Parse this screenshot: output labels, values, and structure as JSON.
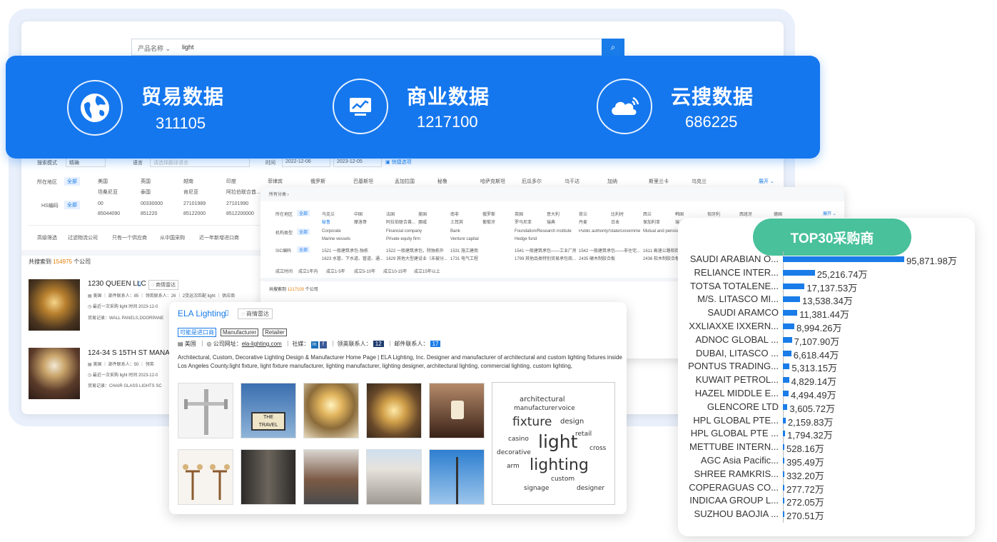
{
  "search": {
    "category": "产品名称",
    "query": "light"
  },
  "stats": [
    {
      "title": "贸易数据",
      "value": "311105"
    },
    {
      "title": "商业数据",
      "value": "1217100"
    },
    {
      "title": "云搜数据",
      "value": "686225"
    }
  ],
  "filters": {
    "search_mode_label": "搜索模式",
    "search_mode_value": "精确",
    "language_label": "语言",
    "language_placeholder": "请选择翻译语言",
    "time_label": "时间",
    "date_from": "2022-12-06",
    "date_to": "2023-12-05",
    "quick_option": "快捷选项",
    "region_label": "所在地区",
    "all": "全部",
    "regions": [
      "美国",
      "英国",
      "越南",
      "印度",
      "菲律宾",
      "俄罗斯",
      "巴基斯坦",
      "孟加拉国",
      "秘鲁",
      "哈萨克斯坦",
      "厄瓜多尔",
      "乌干达",
      "加纳",
      "斯里兰卡",
      "乌克兰"
    ],
    "regions_row2": [
      "坦桑尼亚",
      "泰国",
      "肯尼亚",
      "阿拉伯联合酋..."
    ],
    "hs_label": "HS编码",
    "hs_codes": [
      "00",
      "00330000",
      "27101989",
      "27101990"
    ],
    "hs_codes_row2": [
      "85044090",
      "851220",
      "85122000",
      "8512200000"
    ],
    "expand": "展开",
    "advanced_label": "高级筛选",
    "advanced_options": [
      "过滤物流公司",
      "只有一个供应商",
      "从中国采购",
      "近一年新增进口商"
    ],
    "result_count_prefix": "共搜索到",
    "result_count": "154975",
    "result_count_suffix": "个公司"
  },
  "back_results": [
    {
      "name": "1230 QUEEN LLC",
      "country": "美国",
      "contacts": "部件联系人：85",
      "linkedin": "领英联系人：26",
      "match": "2货运次匹配 light",
      "supplier": "供应商",
      "recent": "最近一次采购 light 时间 2023-12-0",
      "record": "贸易记录：WALL PANELS,DOORPANE"
    },
    {
      "name": "124-34 S 15TH ST MANAGEM",
      "country": "美国",
      "contacts": "部件联系人：50",
      "linkedin": "领英",
      "recent": "最近一次采购 light 时间 2023-12-0",
      "record": "贸易记录：CHAIR GLASS LIGHTS SC"
    }
  ],
  "radar_label": "商情雷达",
  "mid": {
    "breadcrumb": "所有分类",
    "region_label": "所在地区",
    "org_label": "机构类型",
    "sic_label": "SIC编码",
    "all": "全部",
    "regions": [
      "乌克兰",
      "中国",
      "法国",
      "美国",
      "南非",
      "俄罗斯",
      "英国",
      "意大利",
      "荷兰",
      "比利时",
      "西兰",
      "韩国",
      "匈牙利",
      "西班牙",
      "德国"
    ],
    "regions_row2": [
      "秘鲁",
      "摩洛哥",
      "阿拉伯联合酋...",
      "挪威",
      "土耳其",
      "葡萄牙",
      "罗马尼亚",
      "瑞典",
      "丹麦",
      "日本",
      "保加利亚",
      "瑞士"
    ],
    "org_types": [
      "Corporate",
      "Financial company",
      "Bank",
      "Foundation/Research institute",
      "Public authority/State/Government...",
      "Mutual and pension"
    ],
    "org_types_row2": [
      "Marine vessels",
      "Private equity firm",
      "Venture capital",
      "Hedge fund"
    ],
    "sic_codes": [
      "1521 一般建筑承包-独栋",
      "1522 一般建筑承包，除独栋外",
      "1531 施工建商",
      "1541 一般建筑承包——工业厂房...",
      "1542 一般建筑承包——非住宅...",
      "1611 高速公路和街道建设"
    ],
    "sic_codes_row2": [
      "1623 水管、下水道、管道、通...",
      "1629 其他大型建设业（未被分...",
      "1731 电气工程",
      "1799 其他品类特别贸易承包商...",
      "2435 硬木制胶合板",
      "2436 软木制胶合板"
    ],
    "age_label": "成立时间",
    "ages": [
      "成立1年内",
      "成立1-5年",
      "成立5-10年",
      "成立10-15年",
      "成立15年以上"
    ],
    "count_prefix": "共搜索到",
    "count": "1217100",
    "count_suffix": "个公司",
    "expand": "展开"
  },
  "company": {
    "name": "ELA Lighting",
    "radar": "商情雷达",
    "tags": [
      "可能是进口商",
      "Manufacturer",
      "Retailer"
    ],
    "country": "美国",
    "website_label": "公司网址：",
    "website": "ela-lighting.com",
    "social_label": "社媒：",
    "linkedin_label": "领英联系人：",
    "linkedin_count": "12",
    "mail_label": "邮件联系人：",
    "mail_count": "17",
    "description": "Architectural, Custom, Decorative Lighting Design & Manufacturer Home Page | ELA Lighting, Inc. Designer and manufacturer of architectural and custom lighting fixtures inside Los Angeles County.light fixture, light fixture manufacturer, lighting manufacturer, lighting designer, architectural lighting, commercial lighting, custom lighting,",
    "wordcloud": [
      "architectural",
      "manufacturer",
      "voice",
      "fixture",
      "design",
      "retail",
      "casino",
      "light",
      "decorative",
      "cross",
      "arm",
      "lighting",
      "custom",
      "signage",
      "designer"
    ]
  },
  "top30": {
    "title": "TOP30采购商",
    "items": [
      {
        "name": "SAUDI ARABIAN O...",
        "label": "95,871.98万",
        "value": 95871.98
      },
      {
        "name": "RELIANCE INTER...",
        "label": "25,216.74万",
        "value": 25216.74
      },
      {
        "name": "TOTSA TOTALENE...",
        "label": "17,137.53万",
        "value": 17137.53
      },
      {
        "name": "M/S. LITASCO MI...",
        "label": "13,538.34万",
        "value": 13538.34
      },
      {
        "name": "SAUDI ARAMCO",
        "label": "11,381.44万",
        "value": 11381.44
      },
      {
        "name": "XXLIAXXE IXXERN...",
        "label": "8,994.26万",
        "value": 8994.26
      },
      {
        "name": "ADNOC GLOBAL ...",
        "label": "7,107.90万",
        "value": 7107.9
      },
      {
        "name": "DUBAI, LITASCO ...",
        "label": "6,618.44万",
        "value": 6618.44
      },
      {
        "name": "PONTUS TRADING...",
        "label": "5,313.15万",
        "value": 5313.15
      },
      {
        "name": "KUWAIT PETROL...",
        "label": "4,829.14万",
        "value": 4829.14
      },
      {
        "name": "HAZEL MIDDLE E...",
        "label": "4,494.49万",
        "value": 4494.49
      },
      {
        "name": "GLENCORE LTD",
        "label": "3,605.72万",
        "value": 3605.72
      },
      {
        "name": "HPL GLOBAL PTE...",
        "label": "2,159.83万",
        "value": 2159.83
      },
      {
        "name": "HPL GLOBAL PTE ...",
        "label": "1,794.32万",
        "value": 1794.32
      },
      {
        "name": "METTUBE INTERN...",
        "label": "528.16万",
        "value": 528.16
      },
      {
        "name": "AGC Asia Pacific...",
        "label": "395.49万",
        "value": 395.49
      },
      {
        "name": "SHREE RAMKRIS...",
        "label": "332.20万",
        "value": 332.2
      },
      {
        "name": "COPERAGUAS CO...",
        "label": "277.72万",
        "value": 277.72
      },
      {
        "name": "INDICAA GROUP L...",
        "label": "272.05万",
        "value": 272.05
      },
      {
        "name": "SUZHOU BAOJIA ...",
        "label": "270.51万",
        "value": 270.51
      }
    ]
  },
  "chart_data": {
    "type": "bar",
    "title": "TOP30采购商",
    "categories": [
      "SAUDI ARABIAN O...",
      "RELIANCE INTER...",
      "TOTSA TOTALENE...",
      "M/S. LITASCO MI...",
      "SAUDI ARAMCO",
      "XXLIAXXE IXXERN...",
      "ADNOC GLOBAL ...",
      "DUBAI, LITASCO ...",
      "PONTUS TRADING...",
      "KUWAIT PETROL...",
      "HAZEL MIDDLE E...",
      "GLENCORE LTD",
      "HPL GLOBAL PTE...",
      "HPL GLOBAL PTE ...",
      "METTUBE INTERN...",
      "AGC Asia Pacific...",
      "SHREE RAMKRIS...",
      "COPERAGUAS CO...",
      "INDICAA GROUP L...",
      "SUZHOU BAOJIA ..."
    ],
    "values": [
      95871.98,
      25216.74,
      17137.53,
      13538.34,
      11381.44,
      8994.26,
      7107.9,
      6618.44,
      5313.15,
      4829.14,
      4494.49,
      3605.72,
      2159.83,
      1794.32,
      528.16,
      395.49,
      332.2,
      277.72,
      272.05,
      270.51
    ],
    "orientation": "horizontal",
    "unit": "万"
  },
  "colors": {
    "accent": "#1577ee",
    "badge": "#49c19a",
    "bar": "#1a7ce8"
  }
}
